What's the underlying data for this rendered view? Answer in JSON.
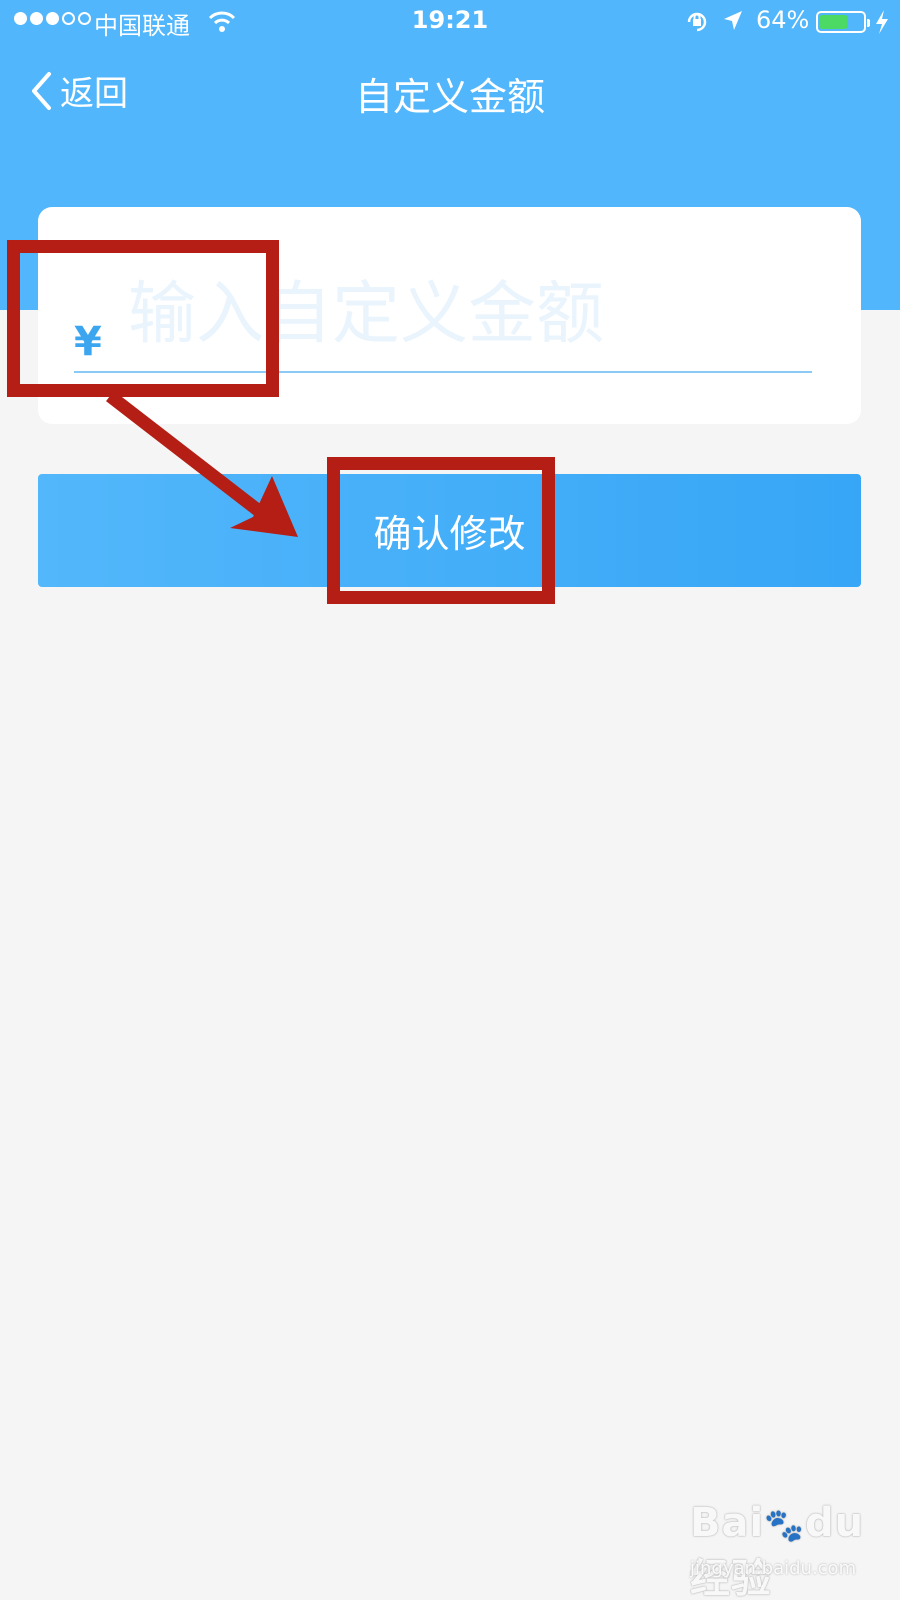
{
  "status_bar": {
    "carrier": "中国联通",
    "time": "19:21",
    "battery_percent": "64%",
    "battery_level": 0.64,
    "signal_filled": 3,
    "signal_total": 5
  },
  "nav": {
    "back_label": "返回",
    "title": "自定义金额"
  },
  "form": {
    "currency_symbol": "¥",
    "amount_placeholder": "输入自定义金额",
    "amount_value": ""
  },
  "confirm_button": {
    "label": "确认修改"
  },
  "annotations": {
    "color": "#b41e14"
  },
  "watermark": {
    "logo": "Bai du经验",
    "url": "jingyan.baidu.com"
  },
  "colors": {
    "header": "#51b6fb",
    "accent": "#3ba5ef",
    "battery_fill": "#4cd964",
    "background": "#f5f5f5"
  },
  "icons": [
    "wifi-icon",
    "orientation-lock-icon",
    "location-arrow-icon",
    "battery-icon",
    "charging-bolt-icon",
    "back-chevron-icon"
  ]
}
